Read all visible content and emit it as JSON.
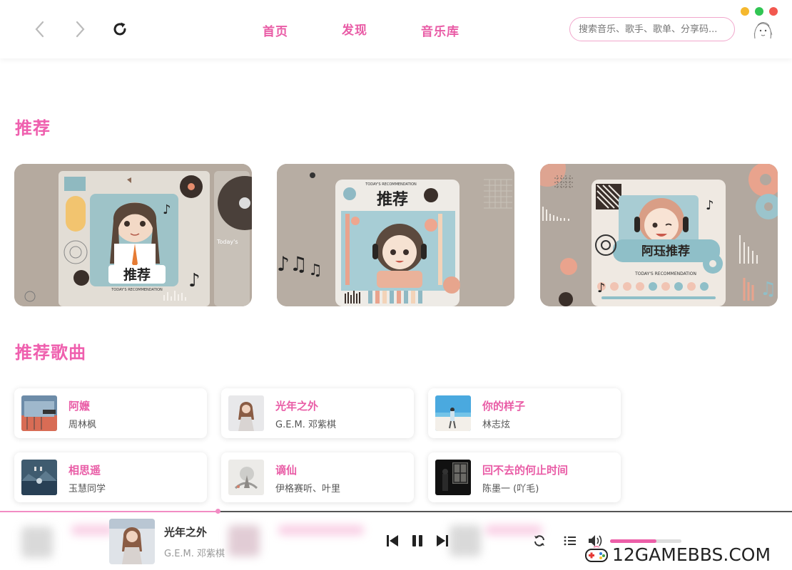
{
  "topbar": {
    "tabs": [
      "首页",
      "发现",
      "音乐库"
    ],
    "search_placeholder": "搜索音乐、歌手、歌单、分享码...",
    "window_dots": [
      "#f5b82e",
      "#31c553",
      "#f2584f"
    ]
  },
  "sections": {
    "recommend_title": "推荐",
    "songs_title": "推荐歌曲"
  },
  "banners": [
    {
      "title": "推荐",
      "subtitle": "TODAY'S RECOMMENDATION",
      "extra": "Today's"
    },
    {
      "title": "推荐",
      "subtitle": "TODAY'S RECOMMENDATION"
    },
    {
      "title": "阿珏推荐",
      "subtitle": "TODAY'S RECOMMENDATION"
    }
  ],
  "songs": [
    {
      "title": "阿嬷",
      "artist": "周林枫"
    },
    {
      "title": "光年之外",
      "artist": "G.E.M. 邓紫棋"
    },
    {
      "title": "你的样子",
      "artist": "林志炫"
    },
    {
      "title": "相思遥",
      "artist": "玉慧同学"
    },
    {
      "title": "谪仙",
      "artist": "伊格赛听、叶里"
    },
    {
      "title": "回不去的何止时间",
      "artist": "陈墨一 (吖毛)"
    }
  ],
  "player": {
    "title": "光年之外",
    "artist": "G.E.M. 邓紫棋",
    "progress": 0.275,
    "volume": 0.65
  },
  "colors": {
    "accent": "#ef5fae"
  },
  "watermark": "12GAMEBBS.COM"
}
